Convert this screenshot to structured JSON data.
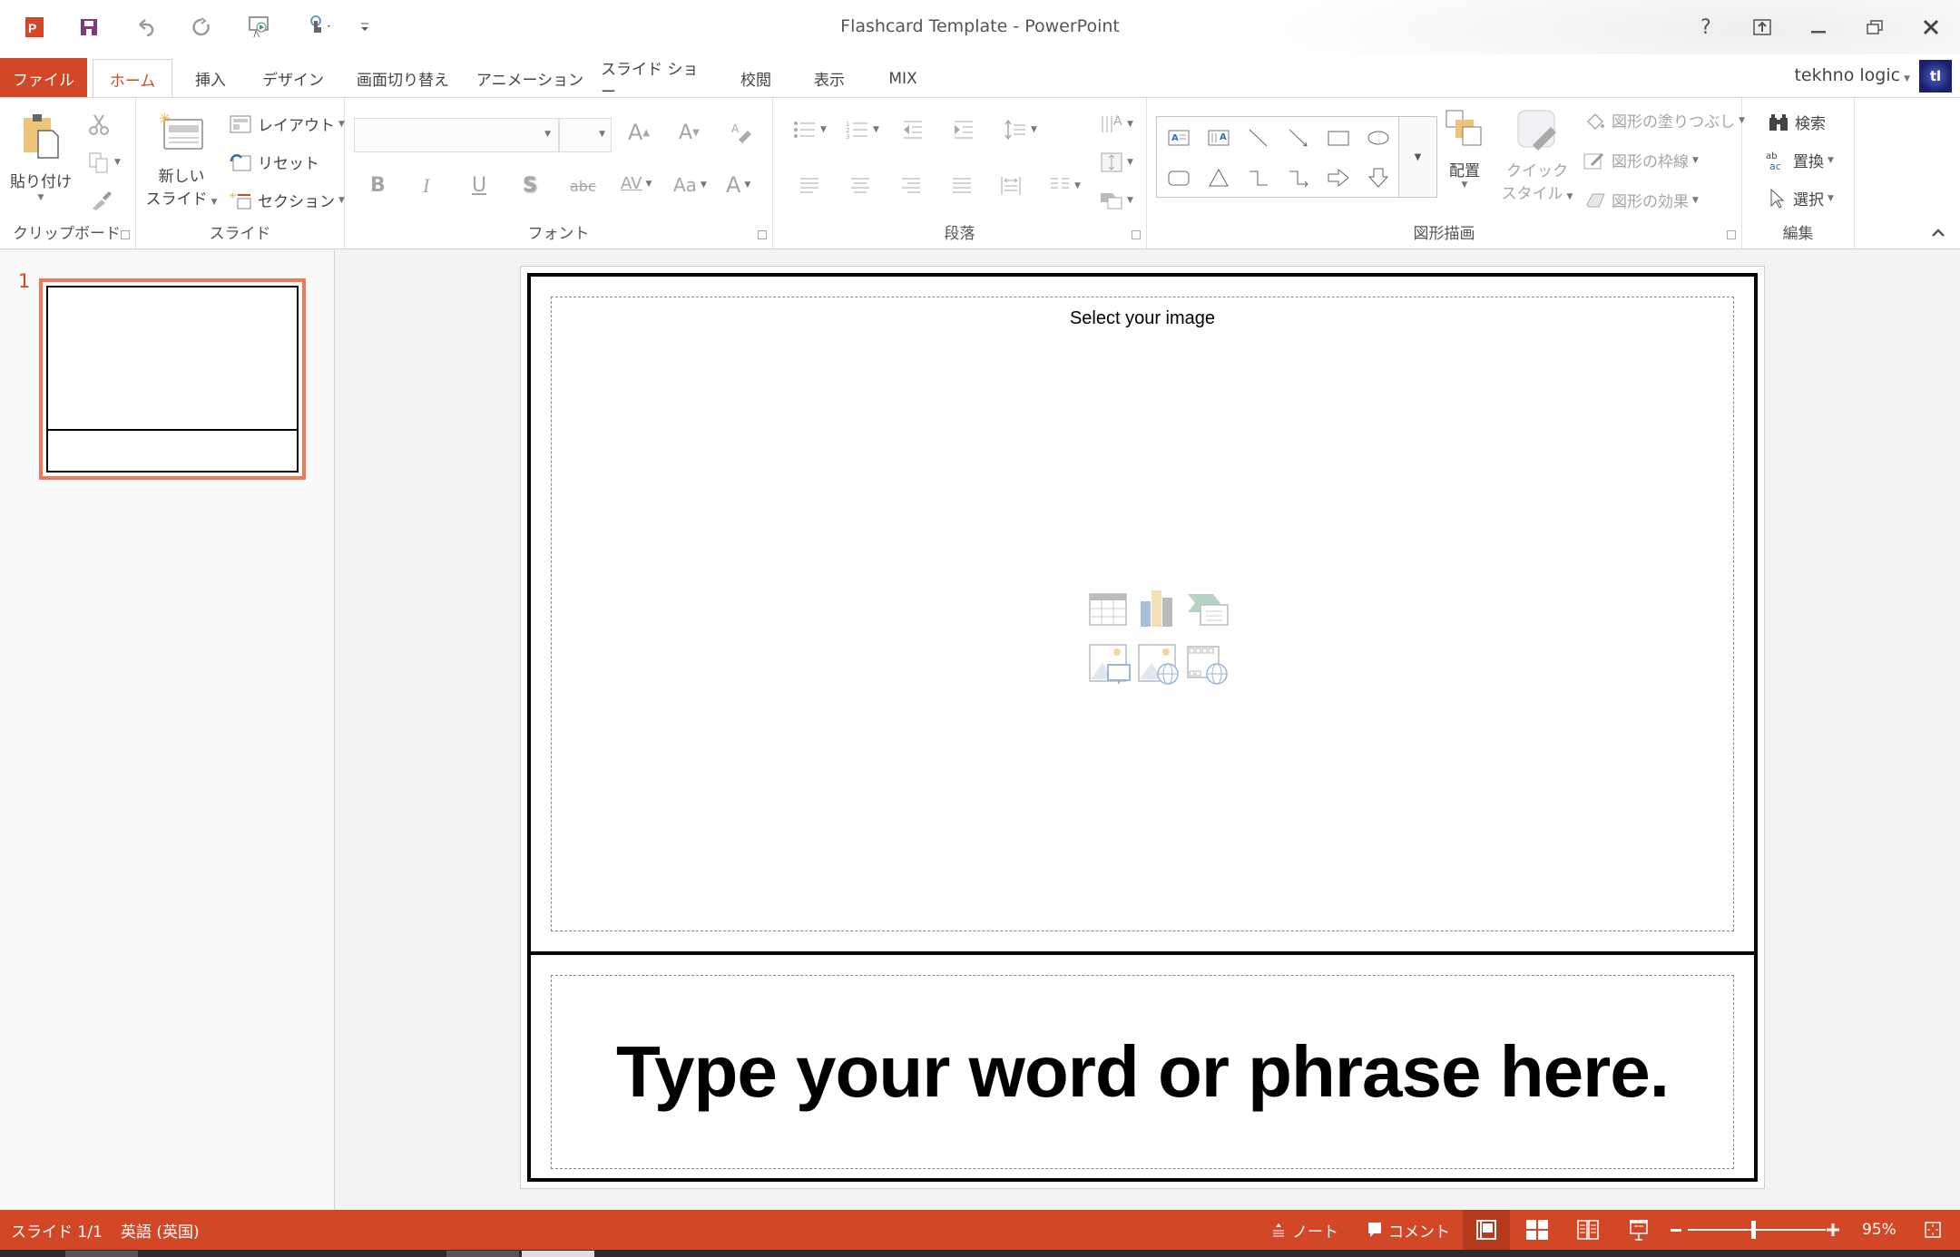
{
  "window": {
    "title": "Flashcard Template - PowerPoint",
    "app_icon": "powerpoint-icon",
    "quick_access": [
      {
        "name": "save",
        "icon": "save-icon"
      },
      {
        "name": "undo",
        "icon": "undo-icon"
      },
      {
        "name": "redo",
        "icon": "redo-icon"
      },
      {
        "name": "present",
        "icon": "start-from-beginning-icon"
      },
      {
        "name": "touch-mode",
        "icon": "touch-mode-icon"
      },
      {
        "name": "customize",
        "icon": "customize-qat-icon"
      }
    ],
    "controls": {
      "help": "?",
      "ribbon_display": "ribbon-display-options-icon",
      "minimize": "minimize-icon",
      "restore": "restore-icon",
      "close": "close-icon"
    }
  },
  "tabs": [
    {
      "label": "ファイル",
      "active": false
    },
    {
      "label": "ホーム",
      "active": true
    },
    {
      "label": "挿入",
      "active": false
    },
    {
      "label": "デザイン",
      "active": false
    },
    {
      "label": "画面切り替え",
      "active": false
    },
    {
      "label": "アニメーション",
      "active": false
    },
    {
      "label": "スライド ショー",
      "active": false
    },
    {
      "label": "校閲",
      "active": false
    },
    {
      "label": "表示",
      "active": false
    },
    {
      "label": "MIX",
      "active": false
    }
  ],
  "user": {
    "name": "tekhno logic",
    "avatar_text": "tl"
  },
  "ribbon": {
    "clipboard": {
      "label": "クリップボード",
      "paste": "貼り付け"
    },
    "slides": {
      "label": "スライド",
      "new_slide_line1": "新しい",
      "new_slide_line2": "スライド",
      "layout": "レイアウト",
      "reset": "リセット",
      "section": "セクション"
    },
    "font": {
      "label": "フォント",
      "font_name": "",
      "font_size": "",
      "bold": "B",
      "italic": "I",
      "underline": "U",
      "shadow": "S",
      "strike": "abc",
      "spacing": "AV",
      "case": "Aa",
      "color": "A"
    },
    "paragraph": {
      "label": "段落"
    },
    "drawing": {
      "label": "図形描画",
      "arrange": "配置",
      "quick_style_line1": "クイック",
      "quick_style_line2": "スタイル",
      "fill": "図形の塗りつぶし",
      "outline": "図形の枠線",
      "effects": "図形の効果"
    },
    "editing": {
      "label": "編集",
      "find": "検索",
      "replace": "置換",
      "select": "選択"
    }
  },
  "slides_pane": {
    "slides": [
      {
        "number": "1",
        "selected": true
      }
    ]
  },
  "slide": {
    "image_placeholder_title": "Select your image",
    "content_icons": [
      "table-icon",
      "chart-icon",
      "smartart-icon",
      "picture-icon",
      "online-picture-icon",
      "online-video-icon"
    ],
    "phrase": "Type your word or phrase here."
  },
  "status": {
    "slide_indicator": "スライド 1/1",
    "language": "英語 (英国)",
    "notes": "ノート",
    "comments": "コメント",
    "zoom_percent": "95%",
    "zoom_value": 95,
    "active_view": "normal"
  }
}
